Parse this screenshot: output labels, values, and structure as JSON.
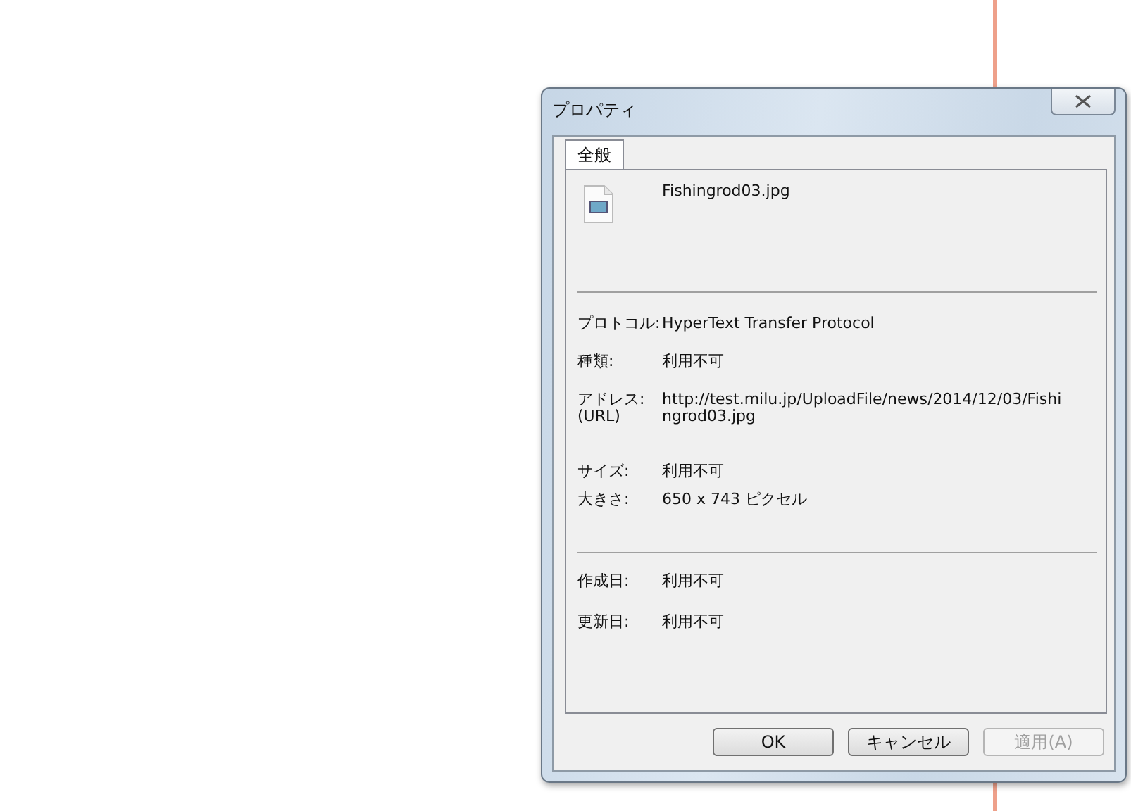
{
  "window": {
    "title": "プロパティ"
  },
  "tabs": [
    {
      "label": "全般",
      "selected": true
    }
  ],
  "file": {
    "name": "Fishingrod03.jpg"
  },
  "sections": [
    {
      "rows": [
        {
          "label": "プロトコル:",
          "value": "HyperText Transfer Protocol"
        },
        {
          "label": "種類:",
          "value": "利用不可"
        },
        {
          "label": "アドレス: (URL)",
          "value": "http://test.milu.jp/UploadFile/news/2014/12/03/Fishingrod03.jpg",
          "kind": "tall"
        },
        {
          "label": "サイズ:",
          "value": "利用不可"
        },
        {
          "label": "大きさ:",
          "value": "650 x 743 ピクセル"
        }
      ]
    },
    {
      "rows": [
        {
          "label": "作成日:",
          "value": "利用不可"
        },
        {
          "label": "更新日:",
          "value": "利用不可"
        }
      ]
    }
  ],
  "buttons": [
    {
      "label": "OK",
      "disabled": false
    },
    {
      "label": "キャンセル",
      "disabled": false
    },
    {
      "label": "適用(A)",
      "disabled": true
    }
  ]
}
